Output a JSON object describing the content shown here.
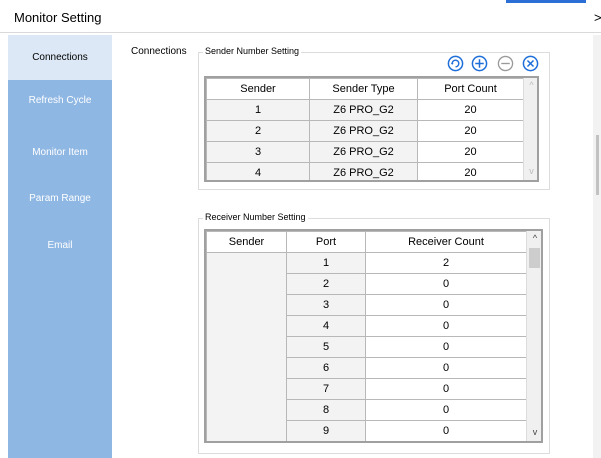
{
  "window": {
    "title": "Monitor Setting",
    "close_glyph": ">"
  },
  "sidebar": {
    "items": [
      {
        "label": "Connections"
      },
      {
        "label": "Refresh Cycle"
      },
      {
        "label": "Monitor Item"
      },
      {
        "label": "Param Range"
      },
      {
        "label": "Email"
      }
    ]
  },
  "main": {
    "section_label": "Connections"
  },
  "sender_group": {
    "legend": "Sender Number Setting",
    "toolbar_icons": [
      "refresh-icon",
      "add-icon",
      "remove-icon",
      "delete-icon"
    ],
    "columns": [
      "Sender",
      "Sender Type",
      "Port Count"
    ],
    "rows": [
      [
        "1",
        "Z6 PRO_G2",
        "20"
      ],
      [
        "2",
        "Z6 PRO_G2",
        "20"
      ],
      [
        "3",
        "Z6 PRO_G2",
        "20"
      ],
      [
        "4",
        "Z6 PRO_G2",
        "20"
      ]
    ]
  },
  "receiver_group": {
    "legend": "Receiver Number Setting",
    "columns": [
      "Sender",
      "Port",
      "Receiver Count"
    ],
    "rows": [
      [
        "1",
        "2"
      ],
      [
        "2",
        "0"
      ],
      [
        "3",
        "0"
      ],
      [
        "4",
        "0"
      ],
      [
        "5",
        "0"
      ],
      [
        "6",
        "0"
      ],
      [
        "7",
        "0"
      ],
      [
        "8",
        "0"
      ],
      [
        "9",
        "0"
      ]
    ]
  },
  "colors": {
    "sidebar": "#8fb7e3",
    "sidebar_active": "#dce8f5",
    "icon_blue": "#1e6fd9",
    "icon_disabled": "#9a9a9a"
  }
}
